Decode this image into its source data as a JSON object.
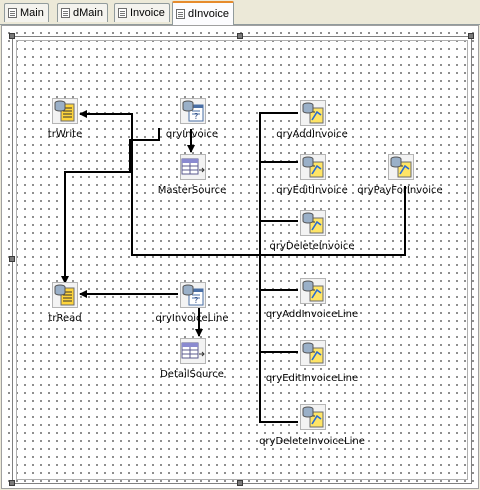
{
  "tabs": [
    {
      "id": "main",
      "label": "Main",
      "active": false
    },
    {
      "id": "dmain",
      "label": "dMain",
      "active": false
    },
    {
      "id": "invoice",
      "label": "Invoice",
      "active": false
    },
    {
      "id": "dinvoice",
      "label": "dInvoice",
      "active": true
    }
  ],
  "components": {
    "trWrite": {
      "label": "trWrite",
      "icon": "transaction-icon"
    },
    "qryInvoice": {
      "label": "qryInvoice",
      "icon": "query-icon"
    },
    "MasterSource": {
      "label": "MasterSource",
      "icon": "datasource-icon"
    },
    "qryAddInvoice": {
      "label": "qryAddInvoice",
      "icon": "stored-proc-icon"
    },
    "qryEditInvoice": {
      "label": "qryEditInvoice",
      "icon": "stored-proc-icon"
    },
    "qryPayForInvoice": {
      "label": "qryPayForInvoice",
      "icon": "stored-proc-icon"
    },
    "qryDeleteInvoice": {
      "label": "qryDeleteInvoice",
      "icon": "stored-proc-icon"
    },
    "trRead": {
      "label": "trRead",
      "icon": "transaction-icon"
    },
    "qryInvoiceLine": {
      "label": "qryInvoiceLine",
      "icon": "query-icon"
    },
    "DetailSource": {
      "label": "DetailSource",
      "icon": "datasource-icon"
    },
    "qryAddInvoiceLine": {
      "label": "qryAddInvoiceLine",
      "icon": "stored-proc-icon"
    },
    "qryEditInvoiceLine": {
      "label": "qryEditInvoiceLine",
      "icon": "stored-proc-icon"
    },
    "qryDeleteInvoiceLine": {
      "label": "qryDeleteInvoiceLine",
      "icon": "stored-proc-icon"
    }
  },
  "colors": {
    "active_tab_accent": "#e68b2c",
    "link_line": "#000000",
    "canvas_background": "#ffffff",
    "grid_dot": "#555555"
  }
}
